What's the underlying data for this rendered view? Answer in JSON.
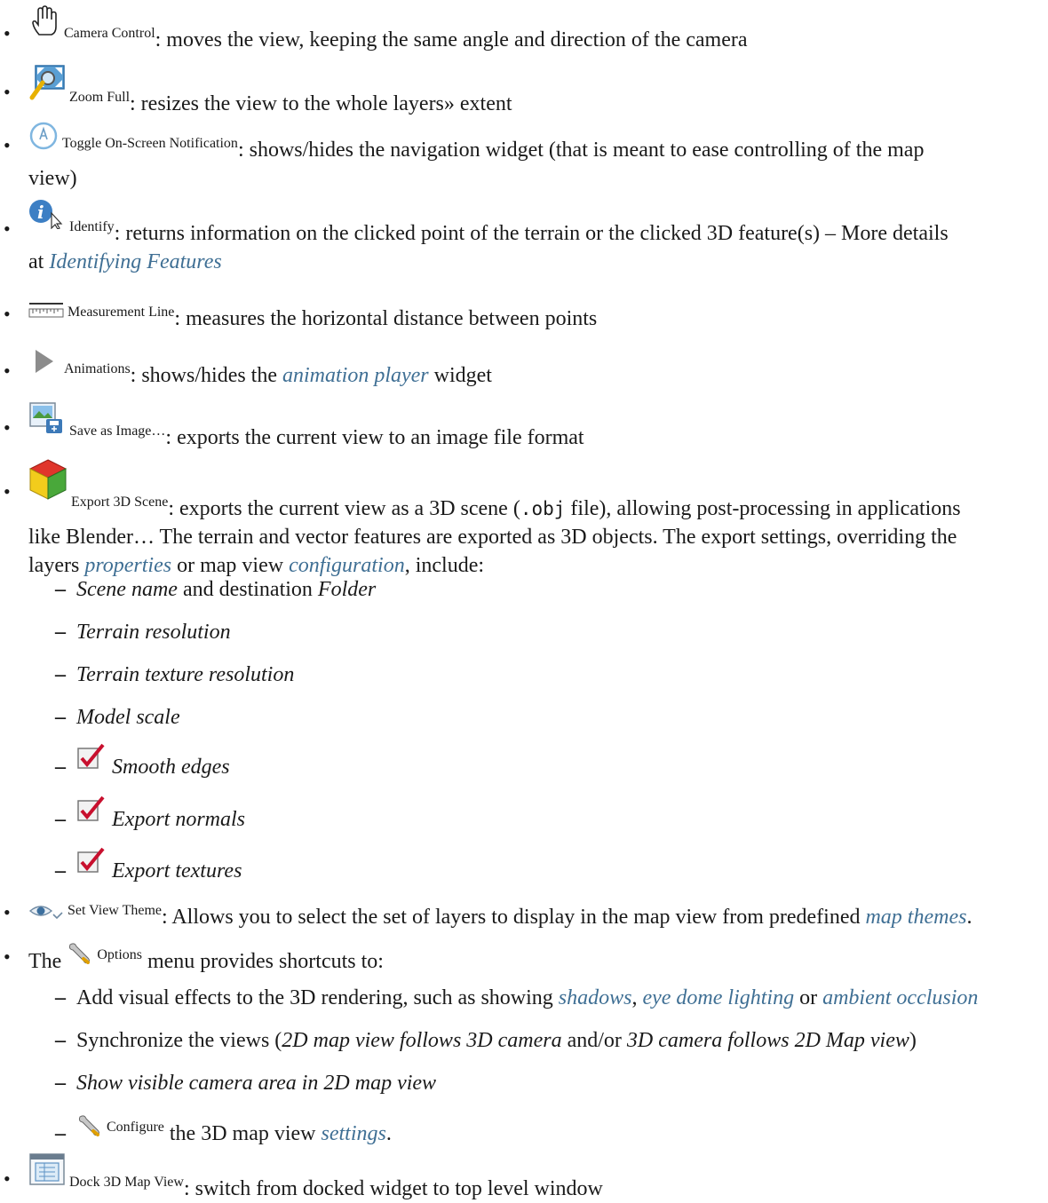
{
  "items": [
    {
      "label": "Camera Control",
      "desc": ": moves the view, keeping the same angle and direction of the camera",
      "icon": "hand-icon"
    },
    {
      "label": "Zoom Full",
      "desc": ": resizes the view to the whole layers» extent",
      "icon": "zoom-full-icon"
    },
    {
      "label": "Toggle On-Screen Notification",
      "desc1": ": shows/hides the navigation widget (that is meant to ease controlling of the map",
      "desc2": "view)",
      "icon": "notification-icon"
    },
    {
      "label": "Identify",
      "desc1": ": returns information on the clicked point of the terrain or the clicked 3D feature(s) – More details",
      "desc2a": "at ",
      "link": "Identifying Features",
      "icon": "identify-icon"
    },
    {
      "label": "Measurement Line",
      "desc": ": measures the horizontal distance between points",
      "icon": "ruler-icon"
    },
    {
      "label": "Animations",
      "desc_a": ": shows/hides the ",
      "link": "animation player",
      "desc_b": " widget",
      "icon": "play-icon"
    },
    {
      "label": "Save as Image…",
      "desc": ": exports the current view to an image file format",
      "icon": "save-image-icon"
    },
    {
      "label": "Export 3D Scene",
      "desc_a": ": exports the current view as a 3D scene (",
      "code": ".obj",
      "desc_b": " file), allowing post-processing in applications",
      "line2": "like Blender… The terrain and vector features are exported as 3D objects. The export settings, overriding the",
      "line3a": "layers ",
      "link1": "properties",
      "line3b": " or map view ",
      "link2": "configuration",
      "line3c": ", include:",
      "icon": "cube-icon"
    }
  ],
  "export_settings": {
    "s1a": "Scene name",
    "s1b": " and destination ",
    "s1c": "Folder",
    "s2": "Terrain resolution",
    "s3": "Terrain texture resolution",
    "s4": "Model scale",
    "s5": "Smooth edges",
    "s6": "Export normals",
    "s7": "Export textures"
  },
  "set_view_theme": {
    "label": "Set View Theme",
    "desc": ": Allows you to select the set of layers to display in the map view from predefined ",
    "link": "map themes",
    "end": "."
  },
  "options": {
    "pre": "The ",
    "label": "Options",
    "post": " menu provides shortcuts to:",
    "o1a": "Add visual effects to the 3D rendering, such as showing ",
    "o1l1": "shadows",
    "o1s1": ", ",
    "o1l2": "eye dome lighting",
    "o1s2": " or ",
    "o1l3": "ambient occlusion",
    "o2a": "Synchronize the views (",
    "o2b": "2D map view follows 3D camera",
    "o2c": " and/or ",
    "o2d": "3D camera follows 2D Map view",
    "o2e": ")",
    "o3": "Show visible camera area in 2D map view",
    "o4label": "Configure",
    "o4a": " the 3D map view ",
    "o4link": "settings",
    "o4end": "."
  },
  "dock": {
    "label": "Dock 3D Map View",
    "desc": ": switch from docked widget to top level window"
  },
  "colors": {
    "link": "#3f6f94",
    "check": "#c8102e"
  }
}
